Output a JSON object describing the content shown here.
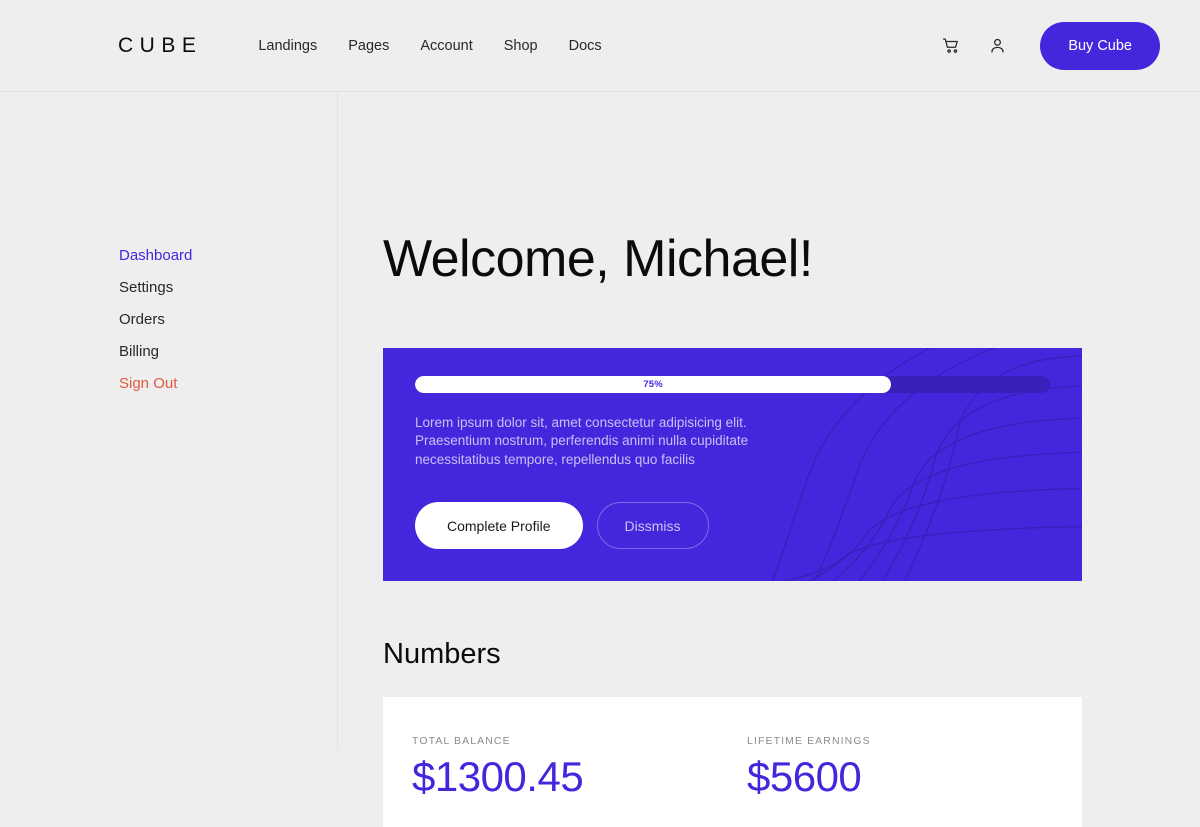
{
  "header": {
    "logo": "CUBE",
    "nav": [
      {
        "label": "Landings"
      },
      {
        "label": "Pages"
      },
      {
        "label": "Account"
      },
      {
        "label": "Shop"
      },
      {
        "label": "Docs"
      }
    ],
    "cart_icon": "shopping-cart-icon",
    "account_icon": "user-icon",
    "buy_label": "Buy Cube"
  },
  "sidebar": {
    "items": [
      {
        "label": "Dashboard",
        "state": "active"
      },
      {
        "label": "Settings",
        "state": "normal"
      },
      {
        "label": "Orders",
        "state": "normal"
      },
      {
        "label": "Billing",
        "state": "normal"
      },
      {
        "label": "Sign Out",
        "state": "danger"
      }
    ]
  },
  "main": {
    "welcome": "Welcome, Michael!",
    "banner": {
      "progress_percent": 75,
      "progress_label": "75%",
      "description": "Lorem ipsum dolor sit, amet consectetur adipisicing elit. Praesentium nostrum, perferendis animi nulla cupiditate necessitatibus tempore, repellendus quo facilis",
      "primary_label": "Complete Profile",
      "secondary_label": "Dissmiss"
    },
    "numbers": {
      "title": "Numbers",
      "stats": [
        {
          "label": "Total Balance",
          "value": "$1300.45"
        },
        {
          "label": "Lifetime Earnings",
          "value": "$5600"
        }
      ]
    }
  },
  "colors": {
    "accent": "#4526dd",
    "danger": "#e2593f",
    "page_bg": "#eeeeee",
    "card_bg": "#ffffff",
    "banner_track": "#3a1fbb"
  }
}
